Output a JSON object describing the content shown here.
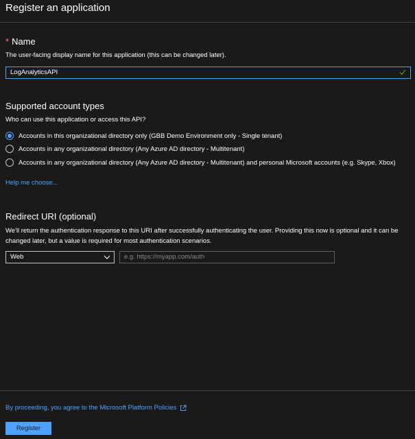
{
  "header": {
    "title": "Register an application"
  },
  "name_section": {
    "required_marker": "*",
    "title": "Name",
    "description": "The user-facing display name for this application (this can be changed later).",
    "value": "LogAnalyticsAPI"
  },
  "account_types": {
    "title": "Supported account types",
    "question": "Who can use this application or access this API?",
    "options": [
      {
        "label": "Accounts in this organizational directory only (GBB Demo Environment only - Single tenant)",
        "selected": true
      },
      {
        "label": "Accounts in any organizational directory (Any Azure AD directory - Multitenant)",
        "selected": false
      },
      {
        "label": "Accounts in any organizational directory (Any Azure AD directory - Multitenant) and personal Microsoft accounts (e.g. Skype, Xbox)",
        "selected": false
      }
    ],
    "help_link": "Help me choose..."
  },
  "redirect": {
    "title": "Redirect URI (optional)",
    "description_line1": "We'll return the authentication response to this URI after successfully authenticating the user. Providing this now is optional and it can be",
    "description_line2": "changed later, but a value is required for most authentication scenarios.",
    "platform_value": "Web",
    "uri_placeholder": "e.g. https://myapp.com/auth"
  },
  "footer": {
    "policy_text": "By proceeding, you agree to the Microsoft Platform Policies",
    "register_label": "Register"
  },
  "colors": {
    "accent": "#4da3ff",
    "background": "#1b1a19",
    "required": "#f1707b",
    "success": "#57a300"
  }
}
